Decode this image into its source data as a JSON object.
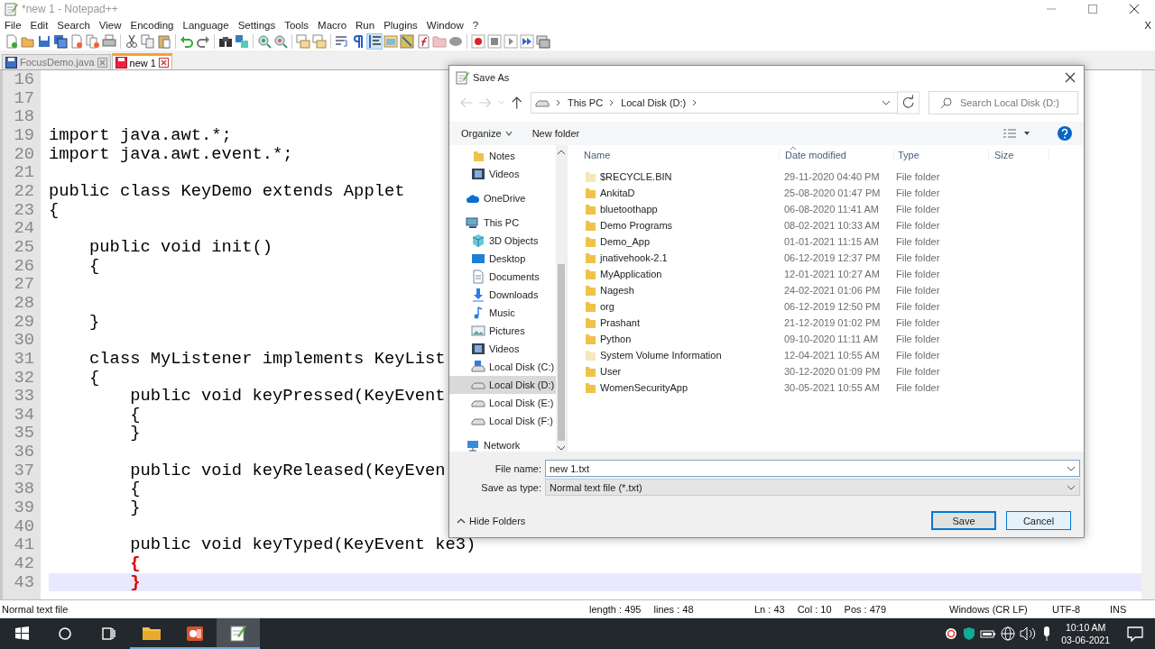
{
  "window": {
    "title": "*new 1 - Notepad++"
  },
  "menu": [
    "File",
    "Edit",
    "Search",
    "View",
    "Encoding",
    "Language",
    "Settings",
    "Tools",
    "Macro",
    "Run",
    "Plugins",
    "Window",
    "?"
  ],
  "menu_close": "X",
  "toolbar": [
    [
      {
        "pressed": false
      },
      {
        "pressed": false
      },
      {
        "pressed": false
      },
      {
        "pressed": false
      },
      {
        "pressed": false
      },
      {
        "pressed": false
      },
      {
        "pressed": false
      }
    ],
    [
      {
        "pressed": false
      },
      {
        "pressed": false
      },
      {
        "pressed": false
      }
    ],
    [
      {
        "pressed": false
      },
      {
        "pressed": false
      }
    ],
    [
      {
        "pressed": false
      },
      {
        "pressed": false
      }
    ],
    [
      {
        "pressed": false
      },
      {
        "pressed": false
      }
    ],
    [
      {
        "pressed": false
      },
      {
        "pressed": false
      }
    ],
    [
      {
        "pressed": false
      },
      {
        "pressed": false
      },
      {
        "pressed": true
      },
      {
        "pressed": false
      },
      {
        "pressed": false
      },
      {
        "pressed": false
      },
      {
        "pressed": false
      },
      {
        "pressed": false
      }
    ],
    [
      {
        "pressed": false
      },
      {
        "pressed": false
      },
      {
        "pressed": false
      },
      {
        "pressed": false
      },
      {
        "pressed": false
      }
    ]
  ],
  "tabs": [
    {
      "label": "FocusDemo.java",
      "selected": false,
      "saved": true
    },
    {
      "label": "new 1",
      "selected": true,
      "saved": false
    }
  ],
  "editor": {
    "lines": [
      {
        "number": "16",
        "current": false
      },
      {
        "number": "17",
        "current": false
      },
      {
        "number": "18",
        "current": false
      },
      {
        "number": "19",
        "text": "import java.awt.*;",
        "current": false,
        "brace_match": false
      },
      {
        "number": "20",
        "text": "import java.awt.event.*;",
        "current": false,
        "brace_match": false
      },
      {
        "number": "21",
        "current": false
      },
      {
        "number": "22",
        "text": "public class KeyDemo extends Applet",
        "current": false,
        "brace_match": false
      },
      {
        "number": "23",
        "text": "{",
        "current": false,
        "brace_match": false
      },
      {
        "number": "24",
        "current": false
      },
      {
        "number": "25",
        "text": "    public void init()",
        "current": false,
        "brace_match": false
      },
      {
        "number": "26",
        "text": "    {",
        "current": false,
        "brace_match": false
      },
      {
        "number": "27",
        "current": false
      },
      {
        "number": "28",
        "current": false
      },
      {
        "number": "29",
        "text": "    }",
        "current": false,
        "brace_match": false
      },
      {
        "number": "30",
        "current": false
      },
      {
        "number": "31",
        "text": "    class MyListener implements KeyList",
        "current": false,
        "brace_match": false
      },
      {
        "number": "32",
        "text": "    {",
        "current": false,
        "brace_match": false
      },
      {
        "number": "33",
        "text": "        public void keyPressed(KeyEvent",
        "current": false,
        "brace_match": false
      },
      {
        "number": "34",
        "text": "        {",
        "current": false,
        "brace_match": false
      },
      {
        "number": "35",
        "text": "        }",
        "current": false,
        "brace_match": false
      },
      {
        "number": "36",
        "current": false
      },
      {
        "number": "37",
        "text": "        public void keyReleased(KeyEven",
        "current": false,
        "brace_match": false
      },
      {
        "number": "38",
        "text": "        {",
        "current": false,
        "brace_match": false
      },
      {
        "number": "39",
        "text": "        }",
        "current": false,
        "brace_match": false
      },
      {
        "number": "40",
        "current": false
      },
      {
        "number": "41",
        "text": "        public void keyTyped(KeyEvent ke3)",
        "current": false,
        "brace_match": false
      },
      {
        "number": "42",
        "text": "        {",
        "current": false,
        "brace_match": true
      },
      {
        "number": "43",
        "text": "        }",
        "current": true,
        "brace_match": true
      }
    ]
  },
  "status_bar": {
    "file_type": "Normal text file",
    "length": "length : 495",
    "lines": "lines : 48",
    "ln": "Ln : 43",
    "col": "Col : 10",
    "pos": "Pos : 479",
    "eol": "Windows (CR LF)",
    "encoding": "UTF-8",
    "mode": "INS"
  },
  "dialog": {
    "title": "Save As",
    "breadcrumb": [
      "This PC",
      "Local Disk (D:)"
    ],
    "search": {
      "placeholder": "Search Local Disk (D:)"
    },
    "commands": {
      "organize": "Organize",
      "new_folder": "New folder"
    },
    "nav": [
      {
        "children": [
          {
            "label": "Notes",
            "kind": "folder",
            "selected": false
          },
          {
            "label": "Videos",
            "kind": "film",
            "selected": false
          }
        ]
      },
      {
        "label": "OneDrive",
        "kind": "cloud",
        "selected": false
      },
      {
        "label": "This PC",
        "kind": "pc",
        "selected": false,
        "children": [
          {
            "label": "3D Objects",
            "kind": "cube",
            "selected": false
          },
          {
            "label": "Desktop",
            "kind": "desktop",
            "selected": false
          },
          {
            "label": "Documents",
            "kind": "document",
            "selected": false
          },
          {
            "label": "Downloads",
            "kind": "download",
            "selected": false
          },
          {
            "label": "Music",
            "kind": "music",
            "selected": false
          },
          {
            "label": "Pictures",
            "kind": "pictures",
            "selected": false
          },
          {
            "label": "Videos",
            "kind": "film",
            "selected": false
          },
          {
            "label": "Local Disk (C:)",
            "kind": "system",
            "selected": false
          },
          {
            "label": "Local Disk (D:)",
            "kind": "drive",
            "selected": true
          },
          {
            "label": "Local Disk (E:)",
            "kind": "drive",
            "selected": false
          },
          {
            "label": "Local Disk (F:)",
            "kind": "drive",
            "selected": false
          }
        ]
      },
      {
        "label": "Network",
        "kind": "network",
        "selected": false
      }
    ],
    "columns": [
      "Name",
      "Date modified",
      "Type",
      "Size"
    ],
    "files": [
      {
        "name": "$RECYCLE.BIN",
        "date": "29-11-2020 04:40 PM",
        "type": "File folder",
        "hidden": true
      },
      {
        "name": "AnkitaD",
        "date": "25-08-2020 01:47 PM",
        "type": "File folder",
        "hidden": false
      },
      {
        "name": "bluetoothapp",
        "date": "06-08-2020 11:41 AM",
        "type": "File folder",
        "hidden": false
      },
      {
        "name": "Demo Programs",
        "date": "08-02-2021 10:33 AM",
        "type": "File folder",
        "hidden": false
      },
      {
        "name": "Demo_App",
        "date": "01-01-2021 11:15 AM",
        "type": "File folder",
        "hidden": false
      },
      {
        "name": "jnativehook-2.1",
        "date": "06-12-2019 12:37 PM",
        "type": "File folder",
        "hidden": false
      },
      {
        "name": "MyApplication",
        "date": "12-01-2021 10:27 AM",
        "type": "File folder",
        "hidden": false
      },
      {
        "name": "Nagesh",
        "date": "24-02-2021 01:06 PM",
        "type": "File folder",
        "hidden": false
      },
      {
        "name": "org",
        "date": "06-12-2019 12:50 PM",
        "type": "File folder",
        "hidden": false
      },
      {
        "name": "Prashant",
        "date": "21-12-2019 01:02 PM",
        "type": "File folder",
        "hidden": false
      },
      {
        "name": "Python",
        "date": "09-10-2020 11:11 AM",
        "type": "File folder",
        "hidden": false
      },
      {
        "name": "System Volume Information",
        "date": "12-04-2021 10:55 AM",
        "type": "File folder",
        "hidden": true
      },
      {
        "name": "User",
        "date": "30-12-2020 01:09 PM",
        "type": "File folder",
        "hidden": false
      },
      {
        "name": "WomenSecurityApp",
        "date": "30-05-2021 10:55 AM",
        "type": "File folder",
        "hidden": false
      }
    ],
    "file_name": {
      "label": "File name:",
      "value": "new 1.txt"
    },
    "save_type": {
      "label": "Save as type:",
      "value": "Normal text file (*.txt)"
    },
    "hide_folders": "Hide Folders",
    "buttons": [
      {
        "label": "Save",
        "default": true,
        "hovered": false
      },
      {
        "label": "Cancel",
        "default": false,
        "hovered": true
      }
    ]
  },
  "taskbar": {
    "apps": [
      {
        "kind": "folder",
        "selected": false
      },
      {
        "kind": "slides",
        "selected": false
      },
      {
        "kind": "notepad",
        "selected": true
      }
    ],
    "time": "10:10 AM",
    "date": "03-06-2021"
  }
}
